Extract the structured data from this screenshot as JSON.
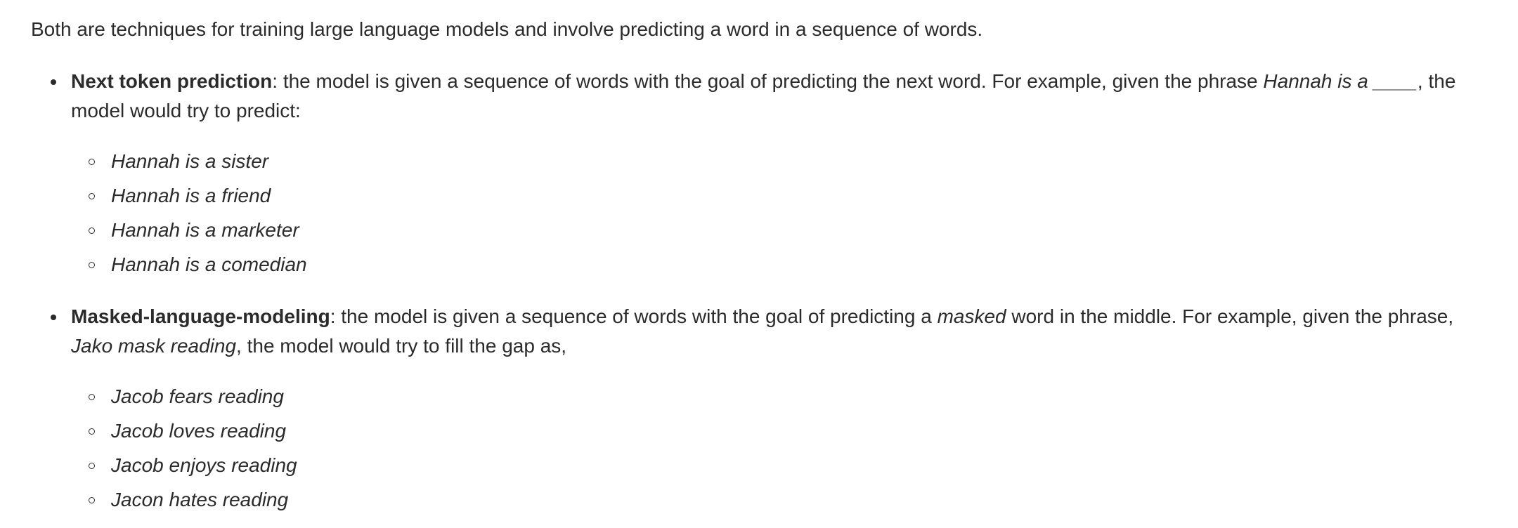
{
  "intro": "Both are techniques for training large language models and involve predicting a word in a sequence of words.",
  "items": [
    {
      "term": "Next token prediction",
      "text_a": ": the model is given a sequence of words with the goal of predicting the next word. For example, given the phrase ",
      "phrase": "Hannah is a ____",
      "text_b": ", the model would try to predict:",
      "examples": [
        "Hannah is a sister",
        "Hannah is a friend",
        "Hannah is a marketer",
        "Hannah is a comedian"
      ]
    },
    {
      "term": "Masked-language-modeling",
      "text_a": ": the model is given a sequence of words with the goal of predicting a ",
      "emph": "masked",
      "text_b": " word in the middle. For example, given the phrase, ",
      "phrase_a": "Jako",
      "phrase_mask": " mask",
      "phrase_b": " reading",
      "text_c": ", the model would try to fill the gap as,",
      "examples": [
        "Jacob fears reading",
        "Jacob loves reading",
        "Jacob enjoys reading",
        "Jacon hates reading"
      ]
    }
  ]
}
